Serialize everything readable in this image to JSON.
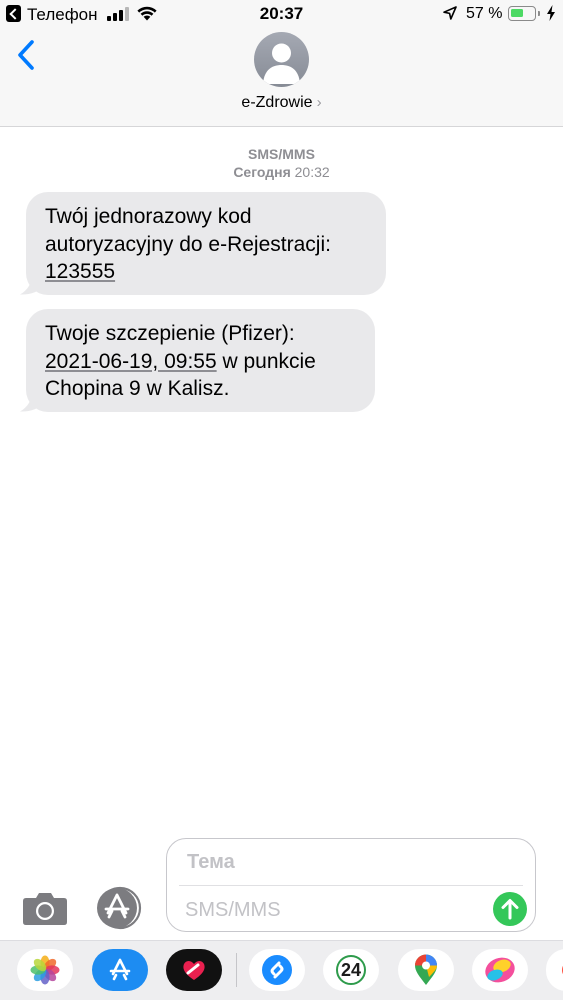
{
  "status_bar": {
    "back_app": "Телефон",
    "time": "20:37",
    "battery_percent": "57 %",
    "battery_level": 0.57
  },
  "nav": {
    "contact_name": "e-Zdrowie",
    "contact_chevron": "›"
  },
  "thread": {
    "message_type": "SMS/MMS",
    "day": "Сегодня",
    "time": "20:32",
    "messages": [
      {
        "lines": [
          "Twój jednorazowy kod",
          "autoryzacyjny do e-Rejestracji:"
        ],
        "link": "123555"
      },
      {
        "line1": "Twoje szczepienie (Pfizer):",
        "link": "2021-06-19, 09:55",
        "after_link": " w punkcie",
        "line3": "Chopina  9 w Kalisz."
      }
    ]
  },
  "compose": {
    "subject_placeholder": "Тема",
    "text_placeholder": "SMS/MMS"
  },
  "app_drawer": {
    "apps": [
      "photos-icon",
      "app-store-icon",
      "digital-touch-icon",
      "shazam-icon",
      "app-24-icon",
      "google-maps-icon",
      "stickers-icon",
      "more-app-icon"
    ],
    "badge_24": "24"
  },
  "colors": {
    "accent": "#007aff",
    "bubble": "#e9e9eb",
    "send": "#34c759",
    "meta_gray": "#8e8e93"
  }
}
